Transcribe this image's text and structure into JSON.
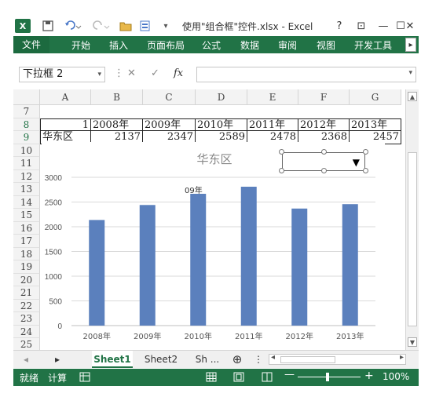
{
  "window": {
    "title": "使用\"组合框\"控件.xlsx - Excel",
    "help": "?",
    "restore_ribbon": "⊡",
    "minimize": "—",
    "maximize": "☐",
    "close": "✕",
    "app_logo": "X",
    "qat": {
      "save_icon": "floppy-icon",
      "undo_icon": "undo-icon",
      "redo_icon": "redo-icon"
    }
  },
  "ribbon": {
    "tabs": [
      "文件",
      "开始",
      "插入",
      "页面布局",
      "公式",
      "数据",
      "审阅",
      "视图",
      "开发工具"
    ],
    "scroll": "▸",
    "color": "#217346"
  },
  "formula_bar": {
    "name_box": "下拉框 2",
    "name_box_dd": "▾",
    "cancel": "✕",
    "enter": "✓",
    "fx": "fx",
    "value": "",
    "dd": "▾"
  },
  "grid": {
    "columns": [
      "A",
      "B",
      "C",
      "D",
      "E",
      "F",
      "G"
    ],
    "rows": [
      "7",
      "8",
      "9",
      "10",
      "11",
      "12",
      "13",
      "14",
      "15",
      "16",
      "17",
      "18",
      "19",
      "20",
      "21",
      "22",
      "23",
      "24",
      "25"
    ],
    "row8": [
      "1",
      "2008年",
      "2009年",
      "2010年",
      "2011年",
      "2012年",
      "2013年"
    ],
    "row9": [
      "华东区",
      "2137",
      "2347",
      "2589",
      "2478",
      "2368",
      "2457"
    ]
  },
  "combo_box": {
    "value": "",
    "arrow": "▼"
  },
  "chart_data": {
    "type": "bar",
    "title": "华东区",
    "categories": [
      "2008年",
      "2009年",
      "2010年",
      "2011年",
      "2012年",
      "2013年"
    ],
    "values": [
      2137,
      2440,
      2700,
      2810,
      2368,
      2457
    ],
    "yticks": [
      "0",
      "500",
      "1000",
      "1500",
      "2000",
      "2500",
      "3000"
    ],
    "ylim": [
      0,
      3000
    ],
    "grid": true,
    "bar_color": "#5b80bd",
    "overlay_text": "09年"
  },
  "sheets": {
    "prev": "◂",
    "next": "▸",
    "tabs": [
      "Sheet1",
      "Sheet2",
      "Sh ..."
    ],
    "add": "⊕",
    "more": "⋮",
    "hs_left": "◂",
    "hs_right": "▸"
  },
  "status": {
    "ready": "就绪",
    "calc": "计算",
    "zoom_minus": "—",
    "zoom_plus": "+",
    "zoom": "100%"
  }
}
